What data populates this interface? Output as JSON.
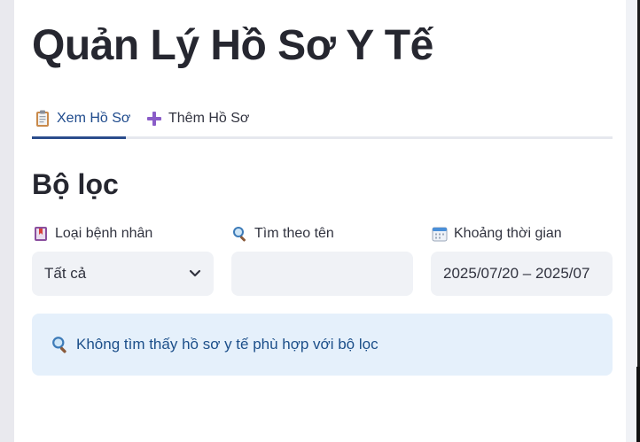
{
  "page": {
    "title": "Quản Lý Hồ Sơ Y Tế"
  },
  "tabs": [
    {
      "label": "Xem Hồ Sơ",
      "icon": "clipboard-icon",
      "active": true
    },
    {
      "label": "Thêm Hồ Sơ",
      "icon": "plus-icon",
      "active": false
    }
  ],
  "filters": {
    "section_title": "Bộ lọc",
    "patient_type": {
      "label": "Loại bệnh nhân",
      "icon": "bookmark-icon",
      "value": "Tất cả"
    },
    "name_search": {
      "label": "Tìm theo tên",
      "icon": "magnifier-icon",
      "value": ""
    },
    "date_range": {
      "label": "Khoảng thời gian",
      "icon": "calendar-icon",
      "value": "2025/07/20 – 2025/07"
    }
  },
  "alert": {
    "icon": "magnifier-icon",
    "message": "Không tìm thấy hồ sơ y tế phù hợp với bộ lọc"
  },
  "colors": {
    "accent": "#2b4d8c",
    "alert_bg": "#e5f0fb",
    "input_bg": "#f0f2f6"
  }
}
